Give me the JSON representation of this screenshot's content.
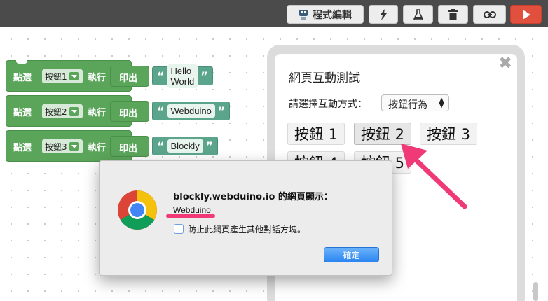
{
  "toolbar": {
    "code_label": "程式編輯",
    "icons": [
      "code-robot-icon",
      "flash-icon",
      "flask-icon",
      "trash-icon",
      "link-icon",
      "play-icon"
    ],
    "run_color": "#e0503d"
  },
  "blocks": [
    {
      "keyword": "點選",
      "button": "按鈕1",
      "action": "執行",
      "print": "印出",
      "text": "Hello World"
    },
    {
      "keyword": "點選",
      "button": "按鈕2",
      "action": "執行",
      "print": "印出",
      "text": "Webduino"
    },
    {
      "keyword": "點選",
      "button": "按鈕3",
      "action": "執行",
      "print": "印出",
      "text": "Blockly"
    }
  ],
  "string_quote_open": "“",
  "string_quote_close": "”",
  "preview": {
    "close": "✖",
    "title": "網頁互動測試",
    "select_label": "請選擇互動方式：",
    "select_value": "按鈕行為",
    "buttons": [
      "按鈕 1",
      "按鈕 2",
      "按鈕 3",
      "按鈕 4",
      "按鈕 5"
    ]
  },
  "dialog": {
    "title": "blockly.webduino.io 的網頁顯示：",
    "message": "Webduino",
    "checkbox_label": "防止此網頁產生其他對話方塊。",
    "ok_label": "確定",
    "highlight_color": "#f03a78"
  }
}
